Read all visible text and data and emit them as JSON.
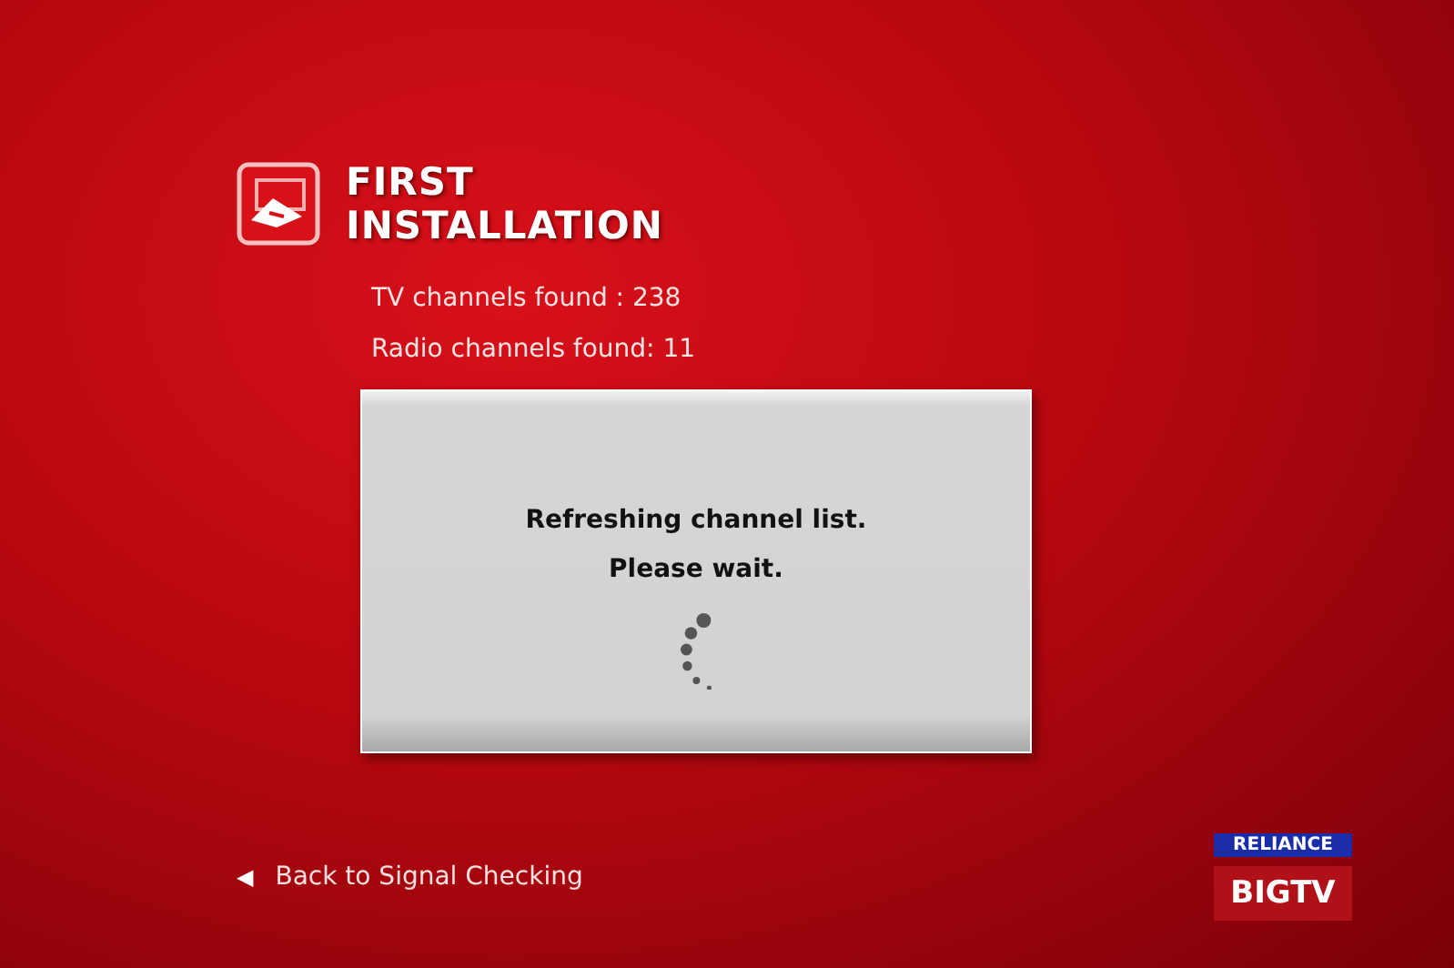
{
  "title": [
    "FIRST",
    "INSTALLATION"
  ],
  "stats": [
    "TV channels found : 238",
    "Radio channels found: 11"
  ],
  "dialog": {
    "lines": [
      "Refreshing channel list.",
      "Please wait."
    ]
  },
  "back_link": {
    "arrow": "◀",
    "label": "Back to Signal Checking"
  },
  "logo": {
    "top": "RELIANCE",
    "bottom": "BIGTV"
  }
}
